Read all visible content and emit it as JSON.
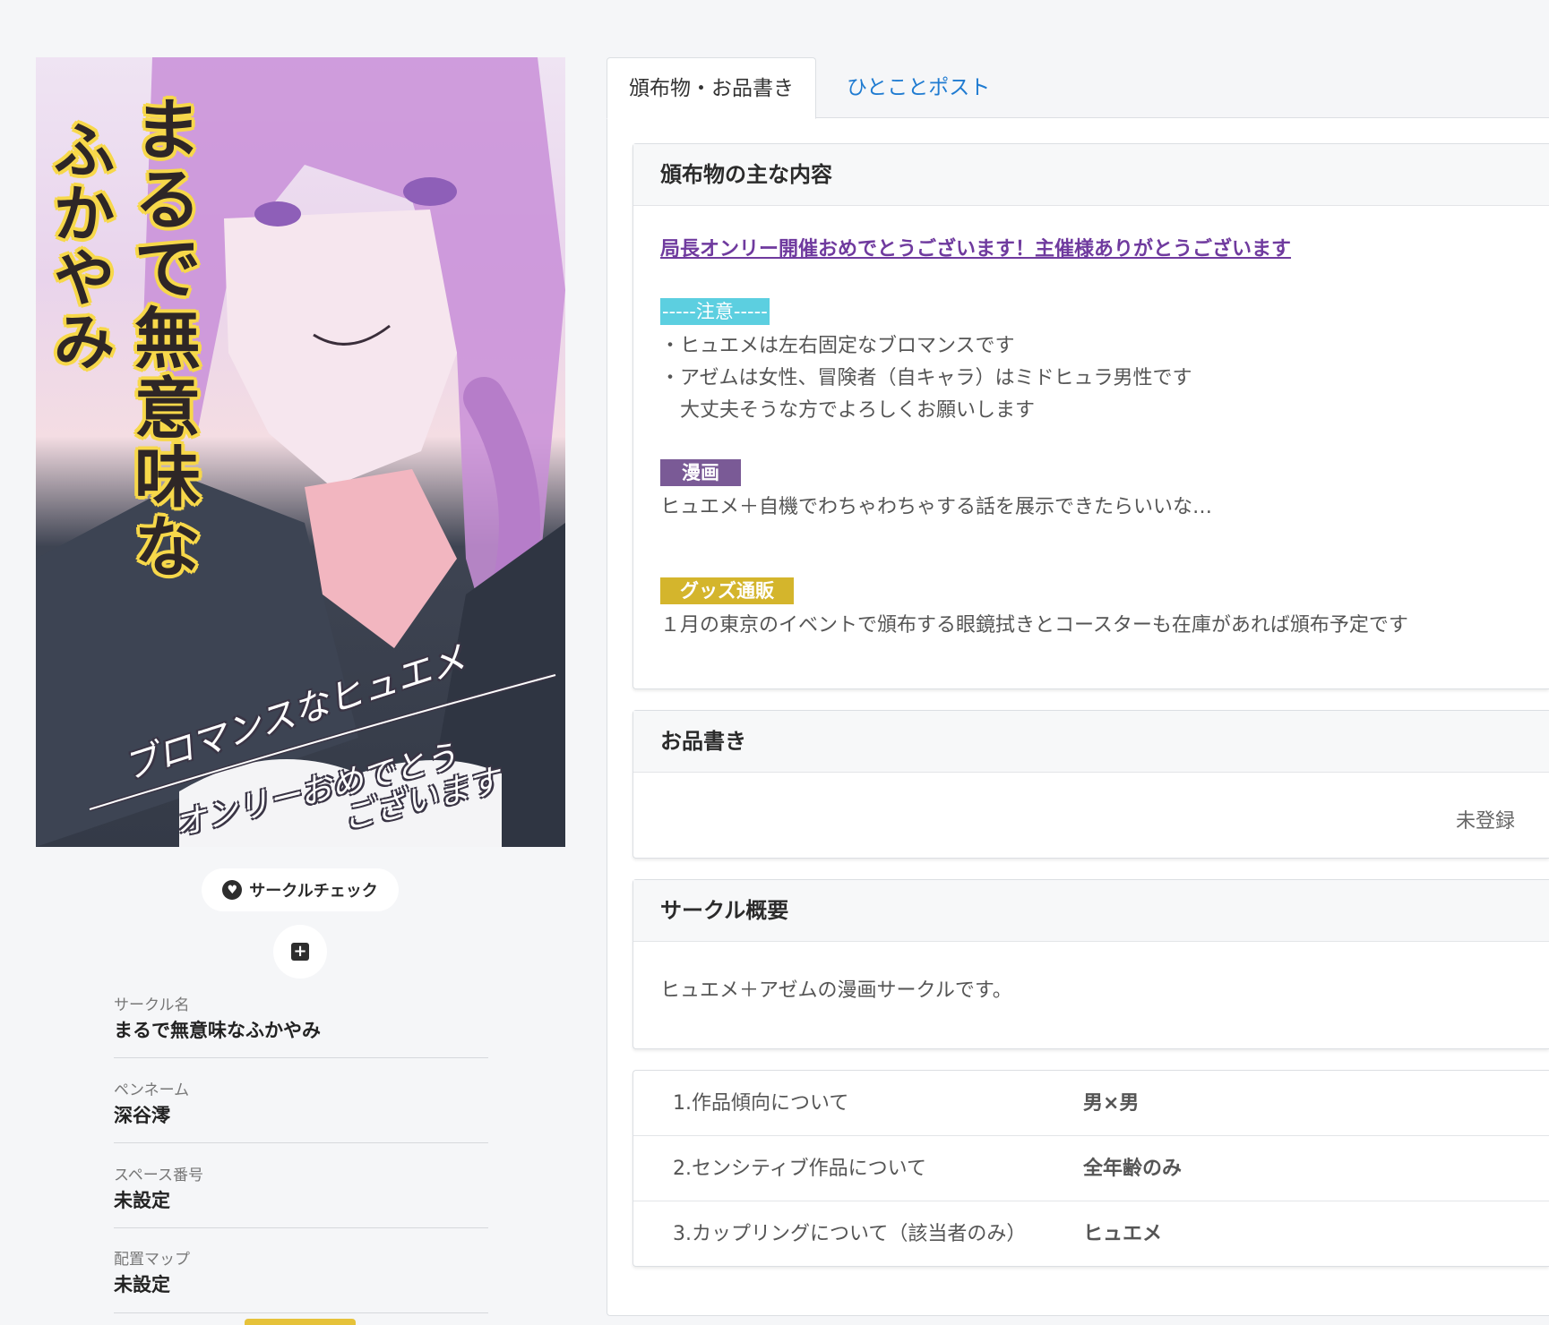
{
  "cover": {
    "title_col1": [
      "ま",
      "る",
      "で",
      "無",
      "意",
      "味",
      "な"
    ],
    "title_col2": [
      "ふ",
      "か",
      "や",
      "み"
    ],
    "handwriting_1": "ブロマンスなヒュエメ",
    "handwriting_2": "オンリーおめでとう",
    "handwriting_3": "ございます"
  },
  "actions": {
    "circle_check_label": "サークルチェック",
    "heart_icon": "heart-icon",
    "add_icon": "plus-square-icon"
  },
  "info": [
    {
      "label": "サークル名",
      "value": "まるで無意味なふかやみ"
    },
    {
      "label": "ペンネーム",
      "value": "深谷澪"
    },
    {
      "label": "スペース番号",
      "value": "未設定"
    },
    {
      "label": "配置マップ",
      "value": "未設定"
    }
  ],
  "tabs": [
    {
      "label": "頒布物・お品書き",
      "active": true
    },
    {
      "label": "ひとことポスト",
      "active": false
    }
  ],
  "contents_card": {
    "title": "頒布物の主な内容",
    "link_text": "局長オンリー開催おめでとうございます！主催様ありがとうございます",
    "notice_chip": "-----注意-----",
    "notice_lines": [
      "・ヒュエメは左右固定なブロマンスです",
      "・アゼムは女性、冒険者（自キャラ）はミドヒュラ男性です",
      "　大丈夫そうな方でよろしくお願いします"
    ],
    "manga_chip": "漫画",
    "manga_text": "ヒュエメ＋自機でわちゃわちゃする話を展示できたらいいな…",
    "goods_chip": "グッズ通販",
    "goods_text": "１月の東京のイベントで頒布する眼鏡拭きとコースターも在庫があれば頒布予定です"
  },
  "menu_card": {
    "title": "お品書き",
    "empty_text": "未登録"
  },
  "summary_card": {
    "title": "サークル概要",
    "text": "ヒュエメ＋アゼムの漫画サークルです。"
  },
  "questions": [
    {
      "q": "1.作品傾向について",
      "a": "男×男"
    },
    {
      "q": "2.センシティブ作品について",
      "a": "全年齢のみ"
    },
    {
      "q": "3.カップリングについて（該当者のみ）",
      "a": "ヒュエメ"
    }
  ],
  "colors": {
    "link": "#6f3a9e",
    "tab_link": "#1f7bd1",
    "chip_cyan": "#5ccfe0",
    "chip_purple": "#7a5a96",
    "chip_gold": "#d4b52c"
  }
}
